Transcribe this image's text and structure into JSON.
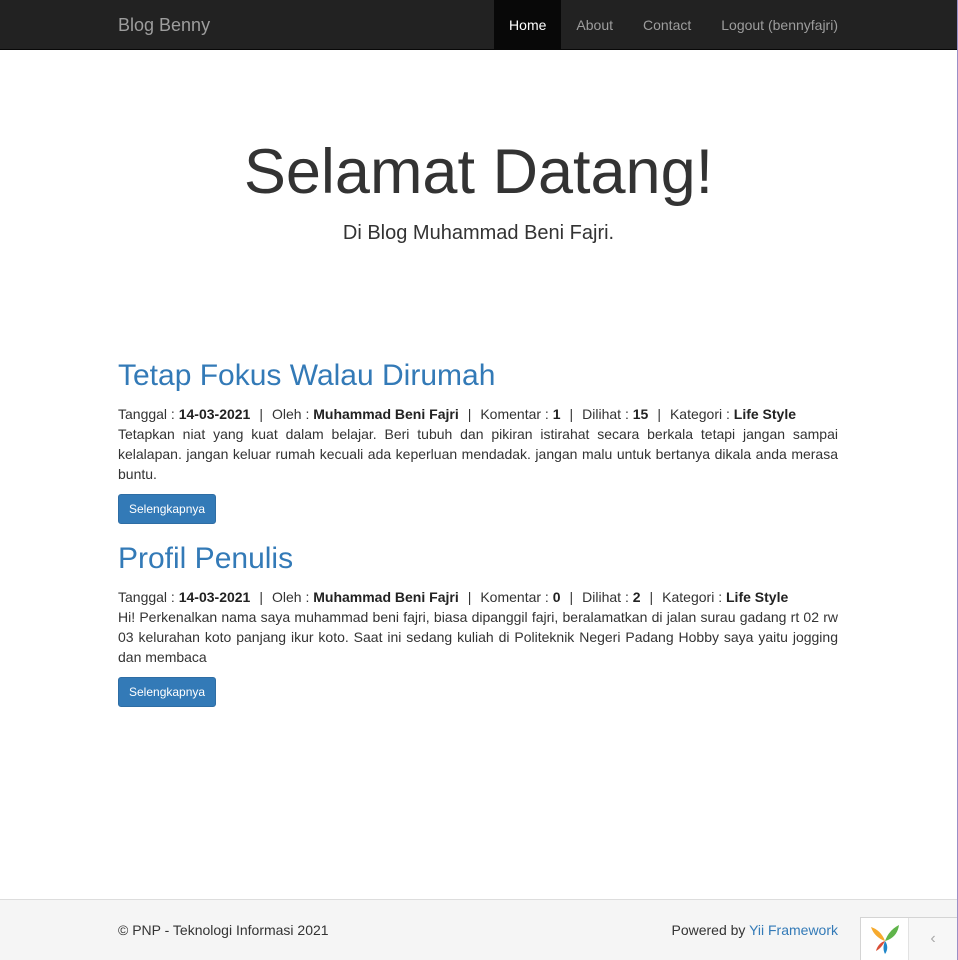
{
  "navbar": {
    "brand": "Blog Benny",
    "items": [
      {
        "label": "Home",
        "active": true
      },
      {
        "label": "About",
        "active": false
      },
      {
        "label": "Contact",
        "active": false
      },
      {
        "label": "Logout (bennyfajri)",
        "active": false
      }
    ]
  },
  "jumbotron": {
    "title": "Selamat Datang!",
    "lead": "Di Blog Muhammad Beni Fajri."
  },
  "posts": [
    {
      "title": "Tetap Fokus Walau Dirumah",
      "tanggal_label": "Tanggal :",
      "tanggal": "14-03-2021",
      "oleh_label": "Oleh :",
      "oleh": "Muhammad Beni Fajri",
      "komentar_label": "Komentar :",
      "komentar": "1",
      "dilihat_label": "Dilihat :",
      "dilihat": "15",
      "kategori_label": "Kategori :",
      "kategori": "Life Style",
      "excerpt": "Tetapkan niat yang kuat dalam belajar. Beri tubuh dan pikiran istirahat secara berkala tetapi jangan sampai kelalapan. jangan keluar rumah kecuali ada keperluan mendadak. jangan malu untuk bertanya dikala anda merasa buntu.",
      "button": "Selengkapnya"
    },
    {
      "title": "Profil Penulis",
      "tanggal_label": "Tanggal :",
      "tanggal": "14-03-2021",
      "oleh_label": "Oleh :",
      "oleh": "Muhammad Beni Fajri",
      "komentar_label": "Komentar :",
      "komentar": "0",
      "dilihat_label": "Dilihat :",
      "dilihat": "2",
      "kategori_label": "Kategori :",
      "kategori": "Life Style",
      "excerpt": "Hi! Perkenalkan nama saya muhammad beni fajri, biasa dipanggil fajri, beralamatkan di jalan surau gadang rt 02 rw 03 kelurahan koto panjang ikur koto. Saat ini sedang kuliah di Politeknik Negeri Padang Hobby saya yaitu jogging dan membaca",
      "button": "Selengkapnya"
    }
  ],
  "footer": {
    "copyright": "© PNP - Teknologi Informasi 2021",
    "powered_prefix": "Powered by",
    "powered_link": "Yii Framework"
  },
  "debug_toolbar": {
    "logo_icon": "yii-logo-icon",
    "toggle_icon": "chevron-left-icon"
  },
  "colors": {
    "navbar_bg": "#222222",
    "link": "#337ab7",
    "button": "#337ab7",
    "footer_bg": "#f5f5f5"
  }
}
